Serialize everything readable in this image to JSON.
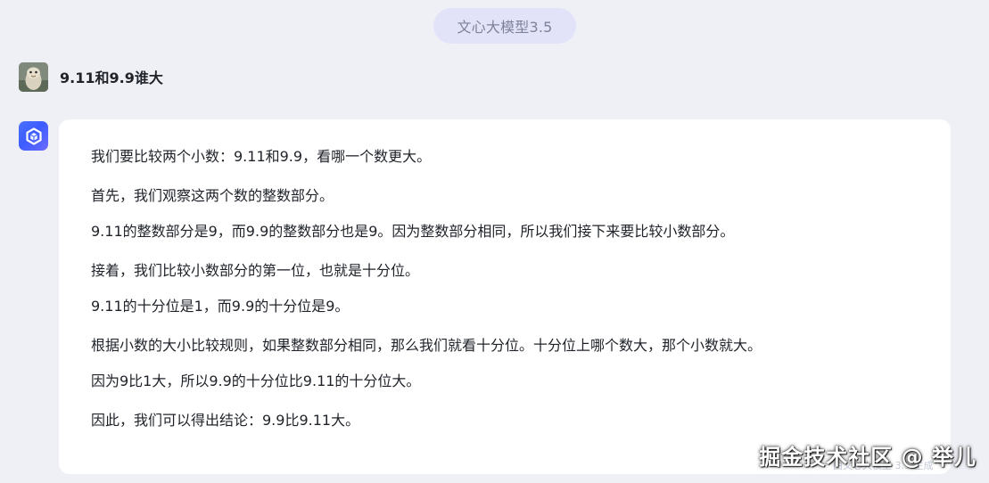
{
  "header": {
    "model_name": "文心大模型3.5"
  },
  "conversation": {
    "user_message": "9.11和9.9谁大",
    "assistant_paragraphs": [
      "我们要比较两个小数：9.11和9.9，看哪一个数更大。",
      "首先，我们观察这两个数的整数部分。",
      "9.11的整数部分是9，而9.9的整数部分也是9。因为整数部分相同，所以我们接下来要比较小数部分。",
      "接着，我们比较小数部分的第一位，也就是十分位。",
      "9.11的十分位是1，而9.9的十分位是9。",
      "根据小数的大小比较规则，如果整数部分相同，那么我们就看十分位。十分位上哪个数大，那个小数就大。",
      "因为9比1大，所以9.9的十分位比9.11的十分位大。",
      "因此，我们可以得出结论：9.9比9.11大。"
    ]
  },
  "watermark": {
    "text": "掘金技术社区 @ 举儿",
    "faint_text": "由文心大模型 3.5 生成"
  },
  "icons": {
    "user_avatar": "user-avatar-icon",
    "bot_avatar": "wenxin-logo-icon"
  },
  "colors": {
    "page_background": "#eff0f6",
    "card_background": "#ffffff",
    "pill_background": "#e2e3f8",
    "brand_blue": "#4b72ff"
  }
}
